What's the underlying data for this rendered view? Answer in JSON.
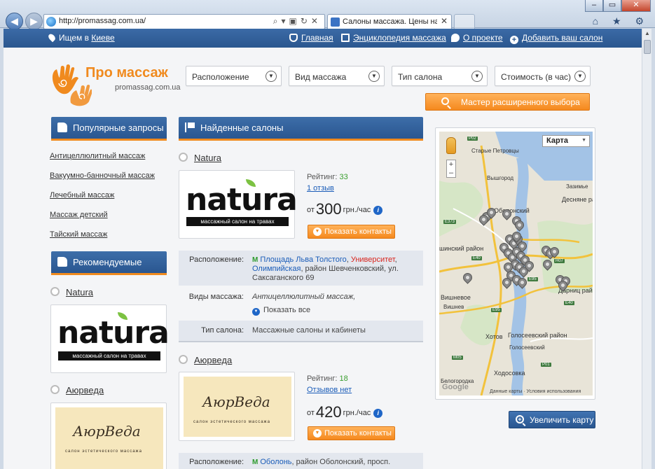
{
  "browser": {
    "url": "http://promassag.com.ua/",
    "tab_title": "Салоны массажа. Цены на массаж в Киеве",
    "window_controls": [
      "–",
      "▭",
      "✕"
    ]
  },
  "topnav": {
    "location_prefix": "Ищем в",
    "location_city": "Киеве",
    "links": [
      {
        "label": "Главная",
        "icon": "hand-icon"
      },
      {
        "label": "Энциклопедия массажа",
        "icon": "book-icon"
      },
      {
        "label": "О проекте",
        "icon": "chat-bubble-icon"
      },
      {
        "label": "Добавить ваш салон",
        "icon": "plus-circle-icon"
      }
    ]
  },
  "logo": {
    "title": "Про массаж",
    "subtitle": "promassag.com.ua",
    "accent_color": "#f08a1e"
  },
  "filters": [
    {
      "label": "Расположение"
    },
    {
      "label": "Вид массажа"
    },
    {
      "label": "Тип салона"
    },
    {
      "label": "Стоимость (в час)"
    }
  ],
  "wizard_button": "Мастер расширенного выбора",
  "sidebar": {
    "popular_title": "Популярные запросы",
    "popular_links": [
      "Антицеллюлитный массаж",
      "Вакуумно-банночный массаж",
      "Лечебный массаж",
      "Массаж детский",
      "Тайский массаж"
    ],
    "recommended_title": "Рекомендуемые",
    "recommended": [
      {
        "name": "Natura"
      },
      {
        "name": "Аюрведа"
      }
    ]
  },
  "logos": {
    "natura_word": "natura",
    "natura_tagline": "массажный салон на травах",
    "ayur_word": "АюрВеда",
    "ayur_tagline": "салон эстетического массажа"
  },
  "main": {
    "found_title": "Найденные салоны",
    "salons": [
      {
        "name": "Natura",
        "rating_label": "Рейтинг:",
        "rating": "33",
        "reviews": "1 отзыв",
        "price_prefix": "от",
        "price": "300",
        "price_unit": "грн./час",
        "contacts_button": "Показать контакты",
        "location_label": "Расположение:",
        "metro_1": "Площадь Льва Толстого",
        "metro_2": "Университет",
        "metro_3": "Олимпийская",
        "location_rest": ", район Шевченковский, ул. Саксаганского 69",
        "types_label": "Виды массажа:",
        "types": "Антицеллюлитный массаж,",
        "show_all": "Показать все",
        "salon_type_label": "Тип салона:",
        "salon_type": "Массажные салоны и кабинеты"
      },
      {
        "name": "Аюрведа",
        "rating_label": "Рейтинг:",
        "rating": "18",
        "reviews": "Отзывов нет",
        "price_prefix": "от",
        "price": "420",
        "price_unit": "грн./час",
        "contacts_button": "Показать контакты",
        "location_label": "Расположение:",
        "metro_1": "Оболонь",
        "location_rest": ", район Оболонский, просп."
      }
    ]
  },
  "map": {
    "type_selector": "Карта",
    "labels": [
      "P02",
      "Старые Петровцы",
      "Вышгород",
      "Зазимье",
      "Десняне район",
      "Оболонский",
      "Е373",
      "шинский район",
      "Е40",
      "Н07",
      "Дарниц район",
      "Е95",
      "Вишневое",
      "Вишнев",
      "Голосеевский район",
      "Хотов",
      "Голосеевский",
      "М05",
      "Р01",
      "Ходосовка",
      "Е40",
      "Белогородка",
      "Е95"
    ],
    "footer": "Данные карты · Условия использования",
    "google": "Google",
    "zoom_plus": "+",
    "zoom_minus": "–",
    "road_color": "#f2c23c",
    "water_color": "#a3c3e6"
  },
  "zoom_map_button": "Увеличить карту",
  "toolbar_icons": "⌂ ★ ⚙"
}
